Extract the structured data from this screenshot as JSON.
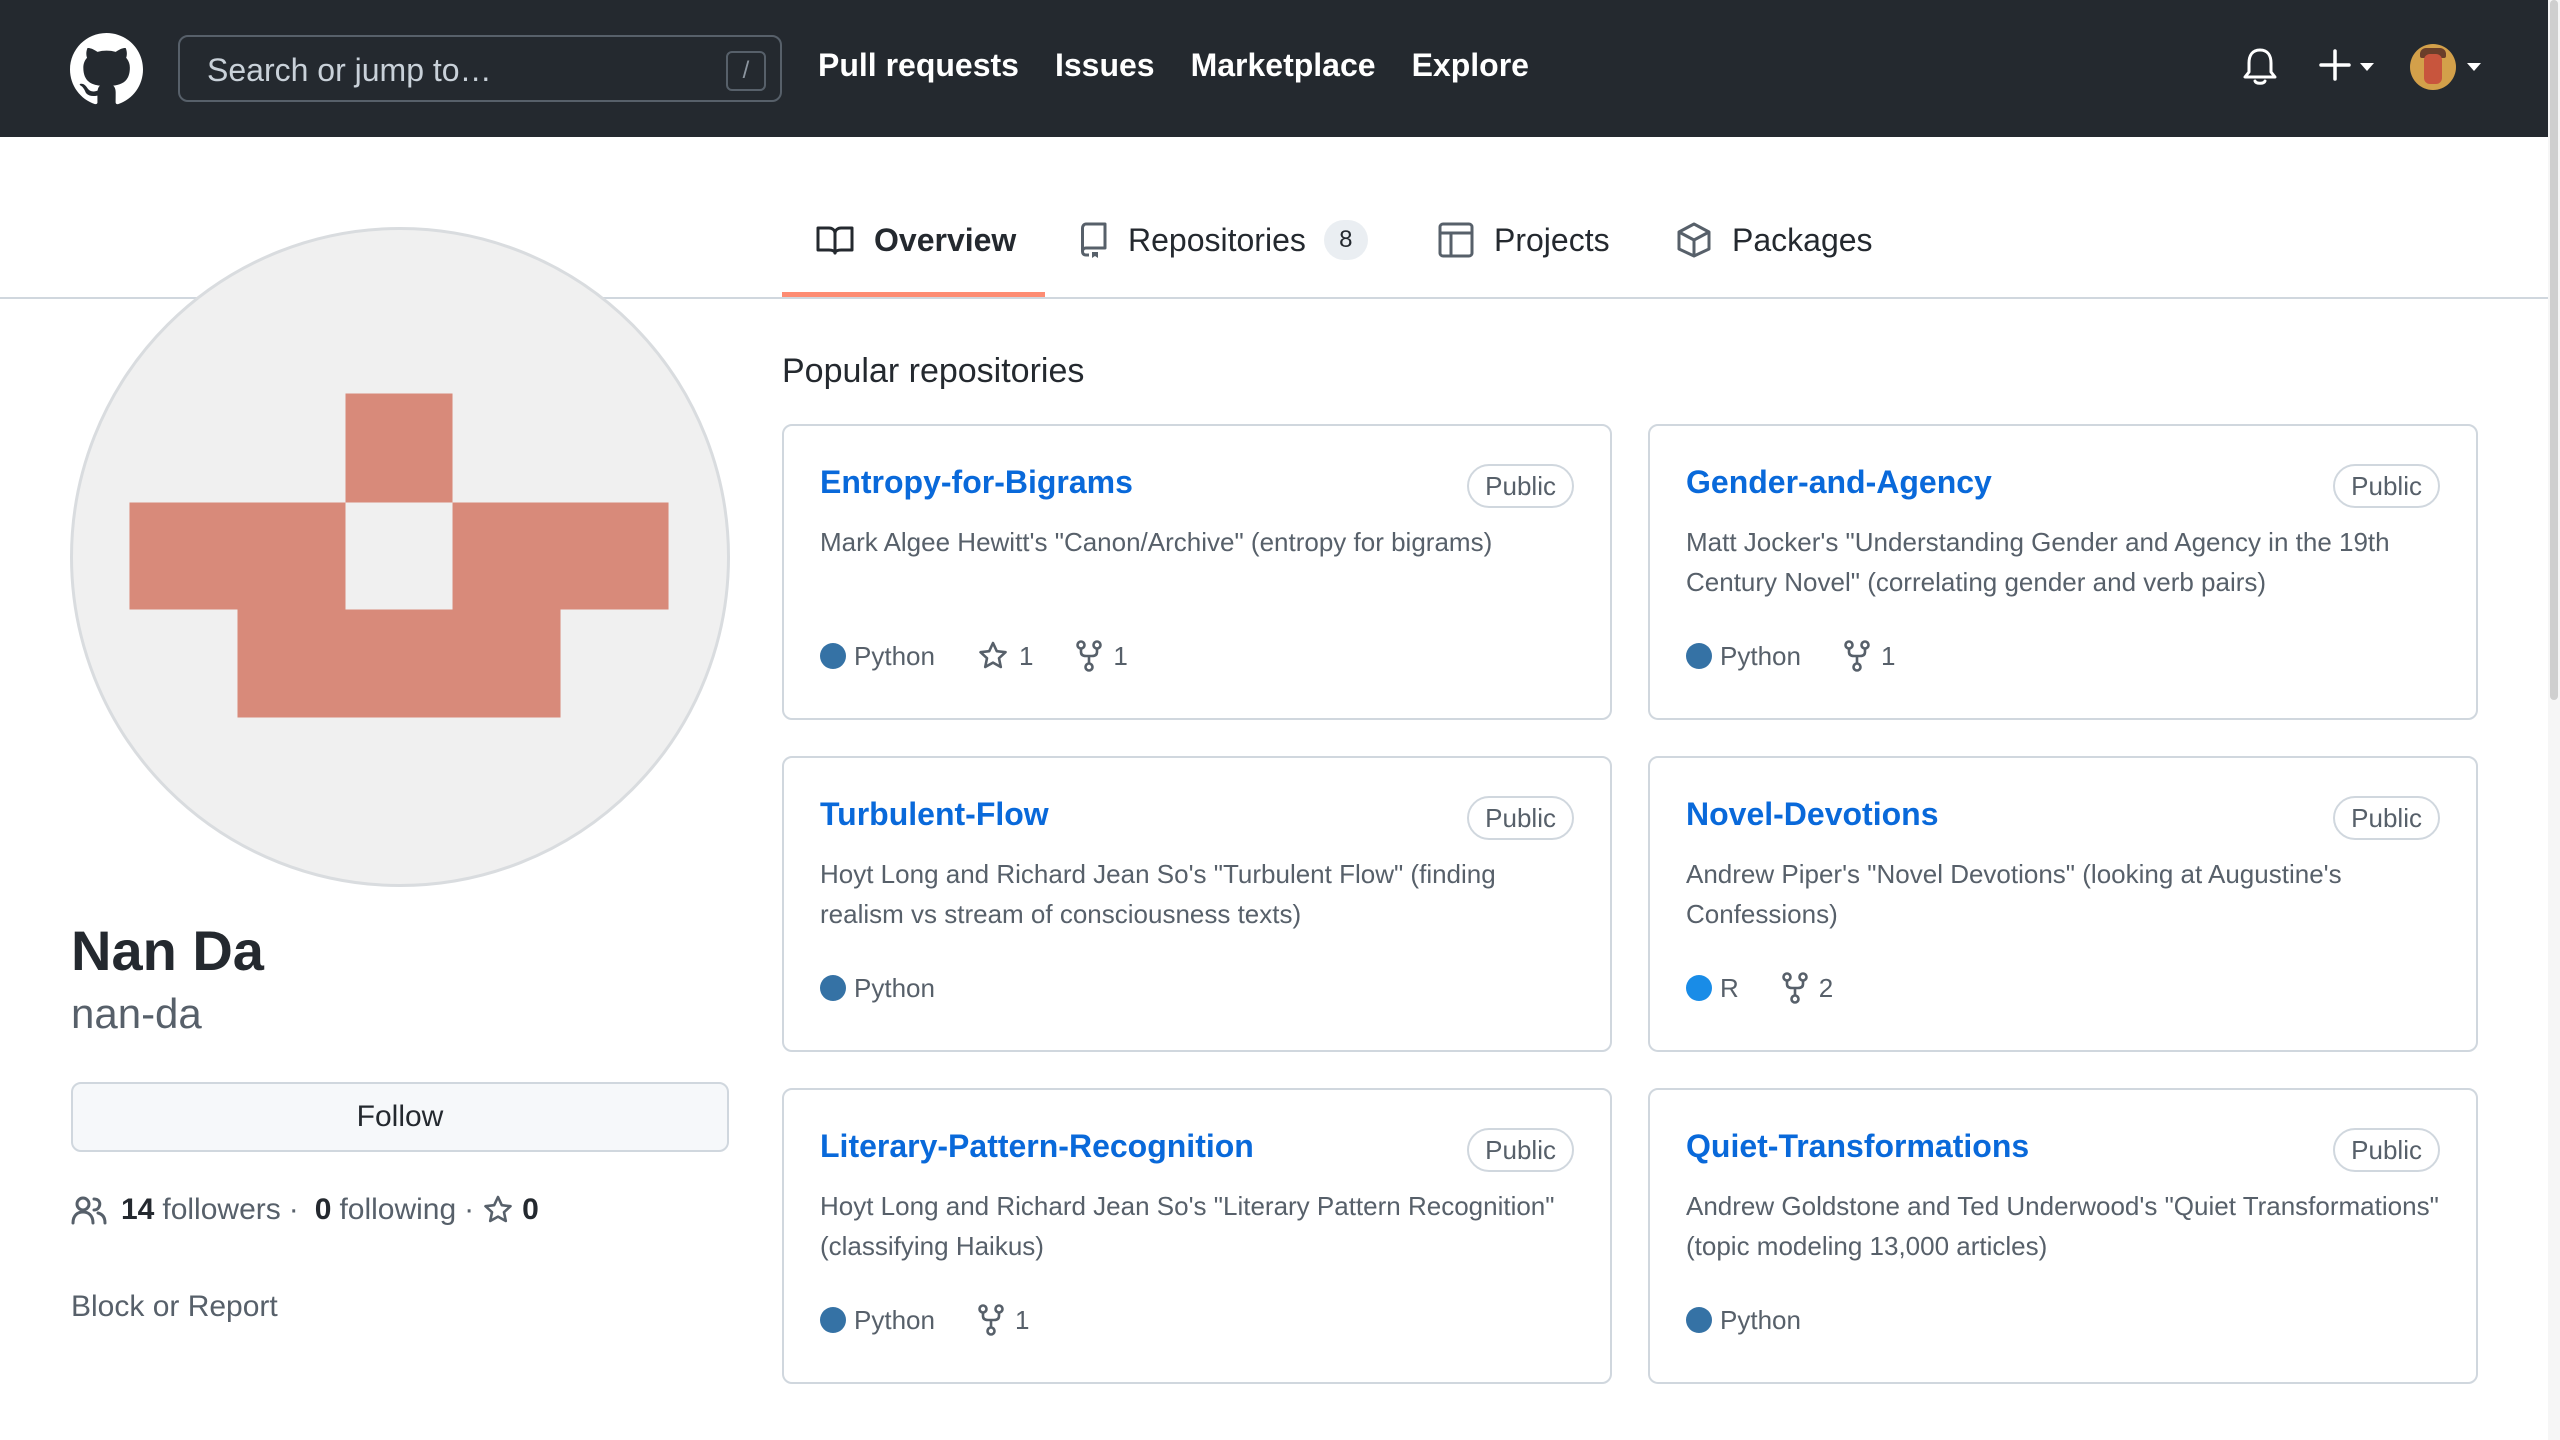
{
  "header": {
    "search_placeholder": "Search or jump to…",
    "search_shortcut": "/",
    "nav": [
      "Pull requests",
      "Issues",
      "Marketplace",
      "Explore"
    ]
  },
  "tabs": {
    "overview": "Overview",
    "repositories": "Repositories",
    "repositories_count": "8",
    "projects": "Projects",
    "packages": "Packages",
    "active": "Overview"
  },
  "profile": {
    "name": "Nan Da",
    "username": "nan-da",
    "follow_label": "Follow",
    "followers_count": "14",
    "followers_label": "followers",
    "following_count": "0",
    "following_label": "following",
    "stars_count": "0",
    "block_report": "Block or Report"
  },
  "popular": {
    "title": "Popular repositories",
    "repos": [
      {
        "name": "Entropy-for-Bigrams",
        "visibility": "Public",
        "description": "Mark Algee Hewitt's \"Canon/Archive\" (entropy for bigrams)",
        "language": "Python",
        "stars": "1",
        "forks": "1"
      },
      {
        "name": "Gender-and-Agency",
        "visibility": "Public",
        "description": "Matt Jocker's \"Understanding Gender and Agency in the 19th Century Novel\" (correlating gender and verb pairs)",
        "language": "Python",
        "forks": "1"
      },
      {
        "name": "Turbulent-Flow",
        "visibility": "Public",
        "description": "Hoyt Long and Richard Jean So's \"Turbulent Flow\" (finding realism vs stream of consciousness texts)",
        "language": "Python"
      },
      {
        "name": "Novel-Devotions",
        "visibility": "Public",
        "description": "Andrew Piper's \"Novel Devotions\" (looking at Augustine's Confessions)",
        "language": "R",
        "forks": "2"
      },
      {
        "name": "Literary-Pattern-Recognition",
        "visibility": "Public",
        "description": "Hoyt Long and Richard Jean So's \"Literary Pattern Recognition\" (classifying Haikus)",
        "language": "Python",
        "forks": "1"
      },
      {
        "name": "Quiet-Transformations",
        "visibility": "Public",
        "description": "Andrew Goldstone and Ted Underwood's \"Quiet Transformations\" (topic modeling 13,000 articles)",
        "language": "Python"
      }
    ]
  },
  "colors": {
    "header_bg": "#24292f",
    "link": "#0969da",
    "tab_underline": "#fd8c73",
    "python": "#3572A5",
    "r": "#198CE7",
    "identicon": "#d88a7a"
  },
  "icons": [
    "github-logo-icon",
    "bell-icon",
    "plus-icon",
    "book-icon",
    "repo-icon",
    "table-icon",
    "package-icon",
    "people-icon",
    "star-icon",
    "fork-icon"
  ]
}
